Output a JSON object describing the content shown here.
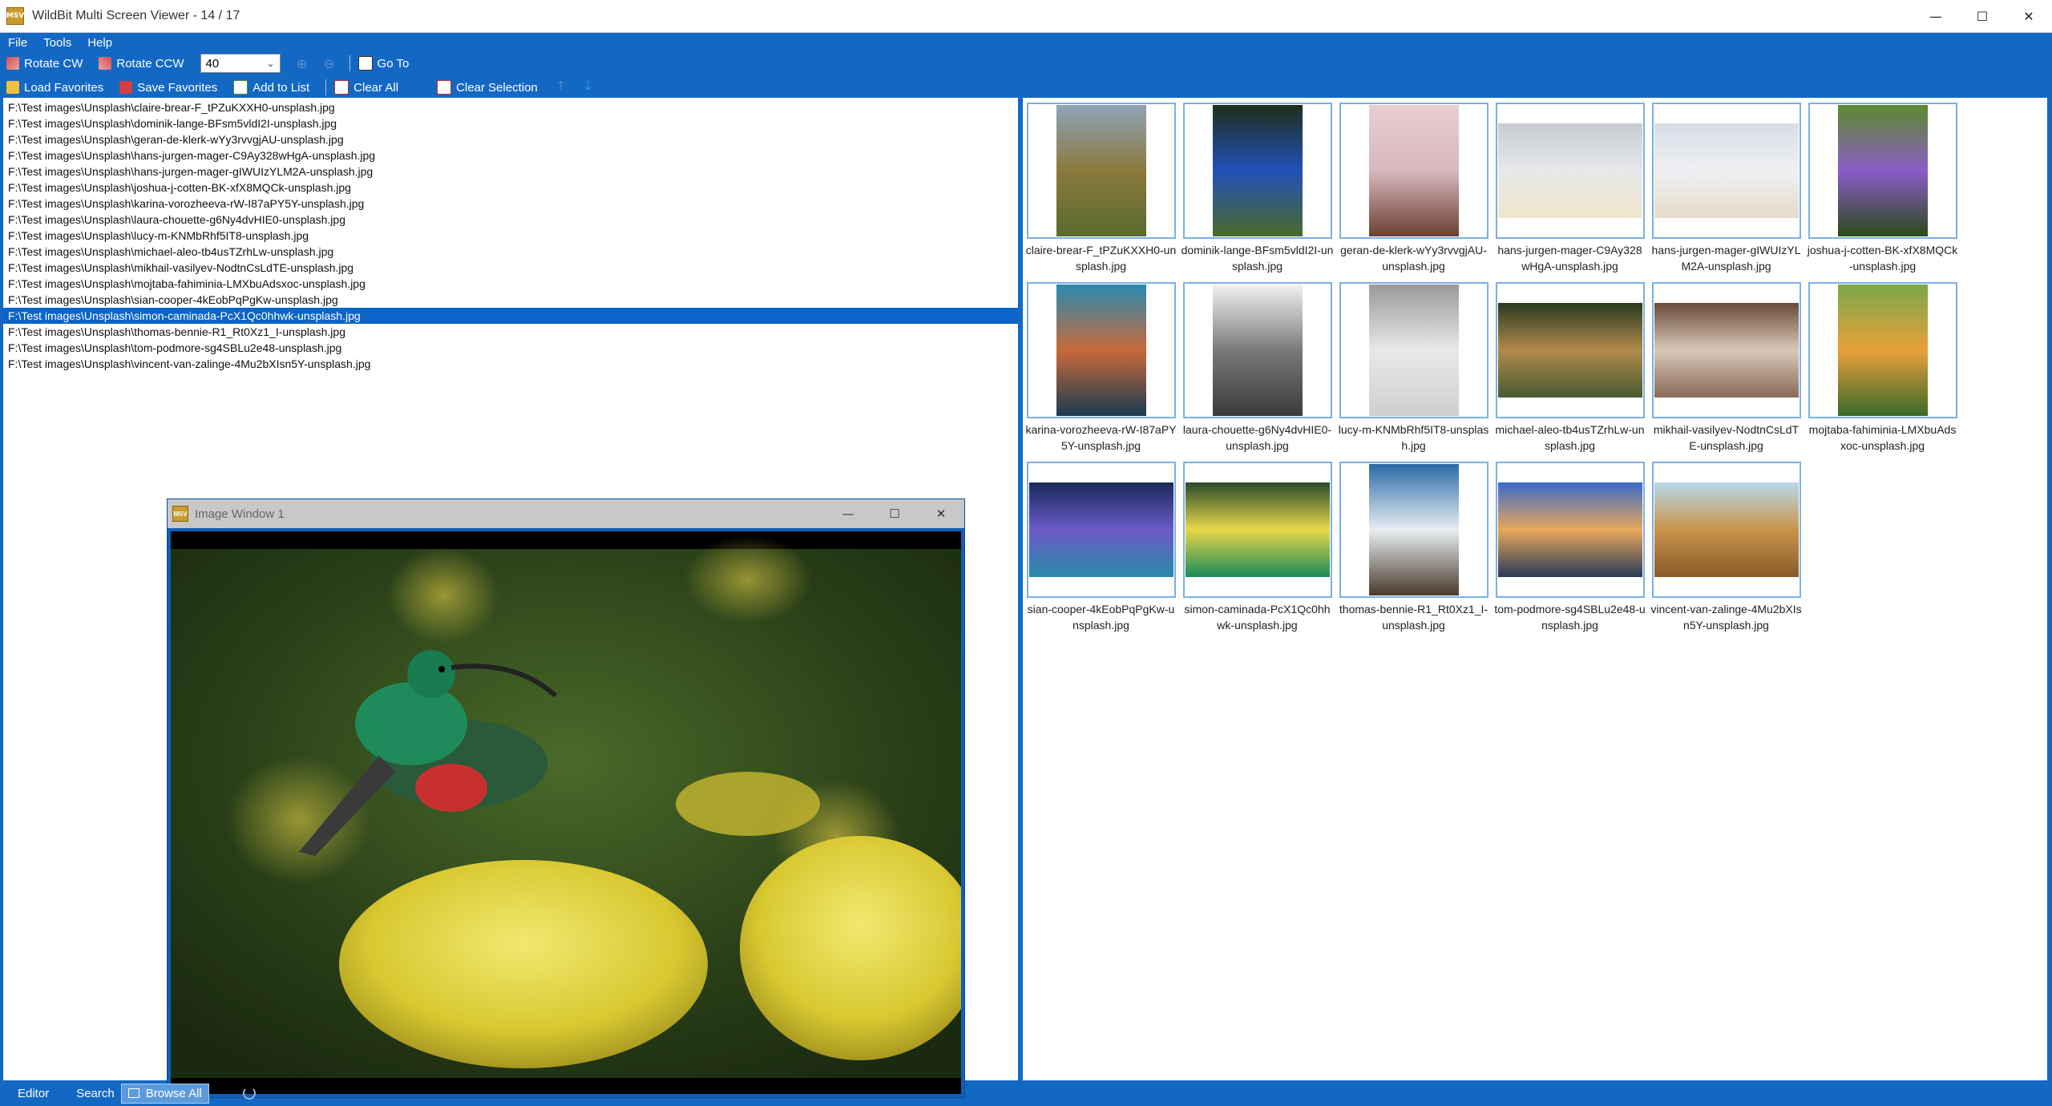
{
  "window": {
    "title": "WildBit Multi Screen Viewer - 14 / 17",
    "app_icon_text": "MSV",
    "minimize_glyph": "—",
    "maximize_glyph": "☐",
    "close_glyph": "✕"
  },
  "menu": [
    "File",
    "Tools",
    "Help"
  ],
  "toolbar1": {
    "rotate_cw": "Rotate CW",
    "rotate_ccw": "Rotate CCW",
    "zoom_value": "40",
    "go_to": "Go To"
  },
  "toolbar2": {
    "load_favorites": "Load Favorites",
    "save_favorites": "Save Favorites",
    "add_to_list": "Add to List",
    "clear_all": "Clear All",
    "clear_selection": "Clear Selection",
    "move_up_glyph": "🡑",
    "move_down_glyph": "🡓"
  },
  "file_list": [
    "F:\\Test images\\Unsplash\\claire-brear-F_tPZuKXXH0-unsplash.jpg",
    "F:\\Test images\\Unsplash\\dominik-lange-BFsm5vldI2I-unsplash.jpg",
    "F:\\Test images\\Unsplash\\geran-de-klerk-wYy3rvvgjAU-unsplash.jpg",
    "F:\\Test images\\Unsplash\\hans-jurgen-mager-C9Ay328wHgA-unsplash.jpg",
    "F:\\Test images\\Unsplash\\hans-jurgen-mager-gIWUIzYLM2A-unsplash.jpg",
    "F:\\Test images\\Unsplash\\joshua-j-cotten-BK-xfX8MQCk-unsplash.jpg",
    "F:\\Test images\\Unsplash\\karina-vorozheeva-rW-I87aPY5Y-unsplash.jpg",
    "F:\\Test images\\Unsplash\\laura-chouette-g6Ny4dvHIE0-unsplash.jpg",
    "F:\\Test images\\Unsplash\\lucy-m-KNMbRhf5IT8-unsplash.jpg",
    "F:\\Test images\\Unsplash\\michael-aleo-tb4usTZrhLw-unsplash.jpg",
    "F:\\Test images\\Unsplash\\mikhail-vasilyev-NodtnCsLdTE-unsplash.jpg",
    "F:\\Test images\\Unsplash\\mojtaba-fahiminia-LMXbuAdsxoc-unsplash.jpg",
    "F:\\Test images\\Unsplash\\sian-cooper-4kEobPqPgKw-unsplash.jpg",
    "F:\\Test images\\Unsplash\\simon-caminada-PcX1Qc0hhwk-unsplash.jpg",
    "F:\\Test images\\Unsplash\\thomas-bennie-R1_Rt0Xz1_I-unsplash.jpg",
    "F:\\Test images\\Unsplash\\tom-podmore-sg4SBLu2e48-unsplash.jpg",
    "F:\\Test images\\Unsplash\\vincent-van-zalinge-4Mu2bXIsn5Y-unsplash.jpg"
  ],
  "selected_index": 13,
  "image_window": {
    "title": "Image Window 1",
    "icon_text": "MSV",
    "minimize_glyph": "—",
    "maximize_glyph": "☐",
    "close_glyph": "✕"
  },
  "thumbnails": [
    {
      "caption": "claire-brear-F_tPZuKXXH0-unsplash.jpg",
      "orient": "portrait",
      "colors": [
        "#8fa3b8",
        "#8a7a3c",
        "#5b6a2e"
      ]
    },
    {
      "caption": "dominik-lange-BFsm5vldI2I-unsplash.jpg",
      "orient": "portrait",
      "colors": [
        "#1e2f1a",
        "#2350b8",
        "#4a6a2c"
      ]
    },
    {
      "caption": "geran-de-klerk-wYy3rvvgjAU-unsplash.jpg",
      "orient": "portrait",
      "colors": [
        "#e6cfd2",
        "#d8b7bd",
        "#6b3f33"
      ]
    },
    {
      "caption": "hans-jurgen-mager-C9Ay328wHgA-unsplash.jpg",
      "orient": "landscape",
      "colors": [
        "#c8ccd2",
        "#e6e8ea",
        "#f0e6cc"
      ]
    },
    {
      "caption": "hans-jurgen-mager-gIWUIzYLM2A-unsplash.jpg",
      "orient": "landscape",
      "colors": [
        "#d8dde6",
        "#eef0f3",
        "#e6dccb"
      ]
    },
    {
      "caption": "joshua-j-cotten-BK-xfX8MQCk-unsplash.jpg",
      "orient": "portrait",
      "colors": [
        "#5c8a2c",
        "#8a5cc8",
        "#2c4a1a"
      ]
    },
    {
      "caption": "karina-vorozheeva-rW-I87aPY5Y-unsplash.jpg",
      "orient": "portrait",
      "colors": [
        "#2a8ab0",
        "#c86a3a",
        "#1a3a50"
      ]
    },
    {
      "caption": "laura-chouette-g6Ny4dvHIE0-unsplash.jpg",
      "orient": "portrait",
      "colors": [
        "#f2f2f2",
        "#7a7a7a",
        "#3a3a3a"
      ]
    },
    {
      "caption": "lucy-m-KNMbRhf5IT8-unsplash.jpg",
      "orient": "portrait",
      "colors": [
        "#9a9a9a",
        "#e8e8e8",
        "#cfcfcf"
      ]
    },
    {
      "caption": "michael-aleo-tb4usTZrhLw-unsplash.jpg",
      "orient": "landscape",
      "colors": [
        "#2a3a22",
        "#b08a4a",
        "#4a5a32"
      ]
    },
    {
      "caption": "mikhail-vasilyev-NodtnCsLdTE-unsplash.jpg",
      "orient": "landscape",
      "colors": [
        "#6a4a3a",
        "#d8c8b8",
        "#8a6a5a"
      ]
    },
    {
      "caption": "mojtaba-fahiminia-LMXbuAdsxoc-unsplash.jpg",
      "orient": "portrait",
      "colors": [
        "#7aa84a",
        "#e8a03a",
        "#3a6a2a"
      ]
    },
    {
      "caption": "sian-cooper-4kEobPqPgKw-unsplash.jpg",
      "orient": "landscape",
      "colors": [
        "#1a2a5a",
        "#6a5ac8",
        "#2a8aa8"
      ]
    },
    {
      "caption": "simon-caminada-PcX1Qc0hhwk-unsplash.jpg",
      "orient": "landscape",
      "colors": [
        "#2a4a2a",
        "#e8d84a",
        "#1a8a5a"
      ]
    },
    {
      "caption": "thomas-bennie-R1_Rt0Xz1_I-unsplash.jpg",
      "orient": "portrait",
      "colors": [
        "#2a6aa8",
        "#e8eef2",
        "#4a3a2a"
      ]
    },
    {
      "caption": "tom-podmore-sg4SBLu2e48-unsplash.jpg",
      "orient": "landscape",
      "colors": [
        "#3a6ac8",
        "#e8a85a",
        "#2a3a5a"
      ]
    },
    {
      "caption": "vincent-van-zalinge-4Mu2bXIsn5Y-unsplash.jpg",
      "orient": "landscape",
      "colors": [
        "#b8d8e8",
        "#c8944a",
        "#8a5a2a"
      ]
    }
  ],
  "statusbar": {
    "editor": "Editor",
    "search": "Search",
    "browse_all": "Browse All"
  },
  "colors": {
    "accent_blue": "#1368c4",
    "selection_blue": "#0c64c8",
    "thumb_border": "#7bb0e6"
  }
}
